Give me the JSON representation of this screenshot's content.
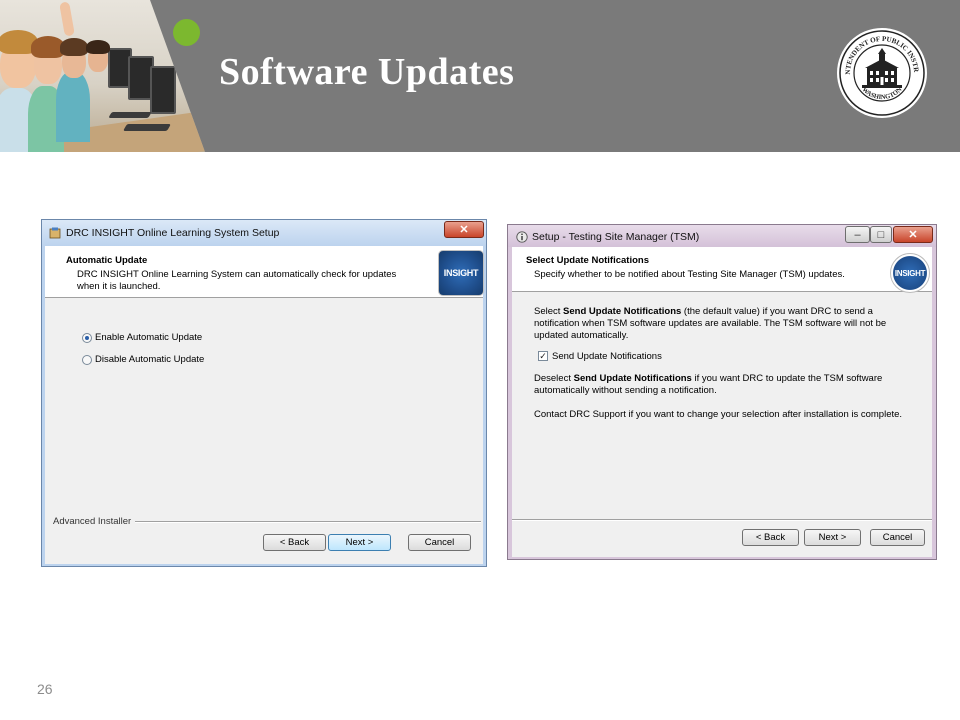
{
  "slide": {
    "title": "Software Updates",
    "page_number": "26"
  },
  "seal": {
    "text_top": "SUPERINTENDENT OF PUBLIC INSTRUCTION",
    "text_bottom": "WASHINGTON"
  },
  "dialog_left": {
    "window_title": "DRC INSIGHT Online Learning System Setup",
    "close_glyph": "✕",
    "header_title": "Automatic Update",
    "header_subtitle_line1": "DRC INSIGHT Online Learning System can automatically check for updates",
    "header_subtitle_line2": "when it is launched.",
    "logo_text": "INSIGHT",
    "option_enable": "Enable Automatic Update",
    "option_disable": "Disable Automatic Update",
    "footer_brand": "Advanced Installer",
    "back_label": "< Back",
    "next_label": "Next >",
    "cancel_label": "Cancel"
  },
  "dialog_right": {
    "window_title": "Setup - Testing Site Manager (TSM)",
    "header_title": "Select Update Notifications",
    "header_subtitle": "Specify whether to be notified about Testing Site Manager (TSM) updates.",
    "logo_text": "INSIGHT",
    "p1_prefix": "Select ",
    "p1_bold": "Send Update Notifications",
    "p1_rest": " (the default value) if you want DRC to send a notification when TSM software updates are available. The TSM software will not be updated automatically.",
    "checkbox_label": "Send Update Notifications",
    "checkbox_glyph": "✓",
    "p2_prefix": "Deselect ",
    "p2_bold": "Send Update Notifications",
    "p2_rest": " if you want DRC to update the TSM software automatically without sending a notification.",
    "p3": "Contact DRC Support if you want to change your selection after installation is complete.",
    "back_label": "< Back",
    "next_label": "Next >",
    "cancel_label": "Cancel",
    "min_glyph": "–",
    "max_glyph": "□",
    "close_glyph": "✕"
  },
  "colors": {
    "banner": "#7a7a7a",
    "accent_green": "#7cb82f",
    "insight_logo_blue": "#1f4e8c"
  }
}
